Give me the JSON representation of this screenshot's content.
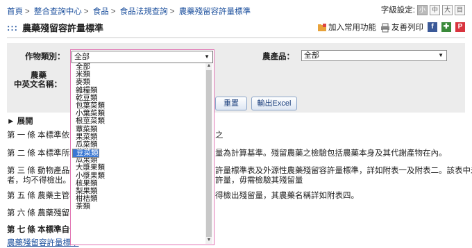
{
  "breadcrumb": [
    "首頁",
    "整合查詢中心",
    "食品",
    "食品法規查詢",
    "農藥殘留容許量標準"
  ],
  "font_size": {
    "label": "字級設定:",
    "buttons": [
      "小",
      "中",
      "大",
      "目"
    ]
  },
  "page_title": "農藥殘留容許量標準",
  "tools": {
    "favorite": "加入常用功能",
    "print": "友善列印"
  },
  "form": {
    "crop_label": "作物類別：",
    "crop_value": "全部",
    "product_label": "農產品：",
    "product_value": "全部",
    "pesticide_label_1": "農藥",
    "pesticide_label_2": "中英文名稱：",
    "reset_label": "重置",
    "export_label": "輸出Excel"
  },
  "expand_label": "展開",
  "paragraphs": [
    "第 一 條 本標準依食",
    "第 二 條 本標準所稱",
    "第 三 條 動物產品殘",
    "者，均不得檢出。",
    "第 五 條 農藥主管機",
    "第 六 條 農藥殘留容",
    "第 七 條 本標準自發"
  ],
  "paragraph_tails": [
    "之",
    "量為計算基準。殘留農藥之檢驗包括農藥本身及其代謝產物在內。",
    "許量標準表及外源性農藥殘留容許量標準，詳如附表一及附表二。該表中未列",
    "許量，毋需檢驗其殘留量",
    "得檢出殘留量，其農藥名稱詳如附表四。",
    "",
    ""
  ],
  "bottom_link": "農藥殘留容許量標準",
  "dropdown": {
    "value": "全部",
    "options": [
      "全部",
      "米類",
      "麥類",
      "雜糧類",
      "乾豆類",
      "包葉菜類",
      "小葉菜類",
      "根莖菜類",
      "蕈菜類",
      "果菜類",
      "瓜菜類",
      "豆菜類",
      "芽菜類",
      "瓜果類",
      "大漿果類",
      "小漿果類",
      "核果類",
      "梨果類",
      "柑桔類",
      "茶類"
    ],
    "selected": "豆菜類"
  }
}
